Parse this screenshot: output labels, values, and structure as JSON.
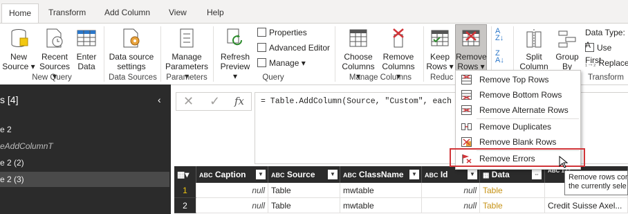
{
  "tabs": [
    {
      "label": "Home"
    },
    {
      "label": "Transform"
    },
    {
      "label": "Add Column"
    },
    {
      "label": "View"
    },
    {
      "label": "Help"
    }
  ],
  "ribbon": {
    "new_source": "New\nSource",
    "new_source_l1": "New",
    "new_source_l2": "Source",
    "recent_l1": "Recent",
    "recent_l2": "Sources",
    "enter_l1": "Enter",
    "enter_l2": "Data",
    "dss_l1": "Data source",
    "dss_l2": "settings",
    "manage_l1": "Manage",
    "manage_l2": "Parameters",
    "refresh_l1": "Refresh",
    "refresh_l2": "Preview",
    "properties": "Properties",
    "advanced_editor": "Advanced Editor",
    "manage": "Manage",
    "choose_l1": "Choose",
    "choose_l2": "Columns",
    "removec_l1": "Remove",
    "removec_l2": "Columns",
    "keep_l1": "Keep",
    "keep_l2": "Rows",
    "remover_l1": "Remove",
    "remover_l2": "Rows",
    "split_l1": "Split",
    "split_l2": "Column",
    "group_l1": "Group",
    "group_l2": "By",
    "data_type": "Data Type: A",
    "use_first": "Use First",
    "replace": "Replace",
    "groups": {
      "new_query": "New Query",
      "data_sources": "Data Sources",
      "parameters": "Parameters",
      "query": "Query",
      "manage_columns": "Manage Columns",
      "reduce": "Reduc",
      "transform": "Transform"
    }
  },
  "left_pane": {
    "title": "s [4]",
    "items": [
      {
        "label": "e 2"
      },
      {
        "label": "eAddColumnT"
      },
      {
        "label": "e 2 (2)"
      },
      {
        "label": "e 2 (3)"
      }
    ]
  },
  "formula": {
    "fx": "fx",
    "text": "= Table.AddColumn(Source, \"Custom\", each [D"
  },
  "grid": {
    "columns": [
      {
        "type": "ABC",
        "name": "Caption"
      },
      {
        "type": "ABC",
        "name": "Source"
      },
      {
        "type": "ABC",
        "name": "ClassName"
      },
      {
        "type": "ABC",
        "name": "Id"
      },
      {
        "type": "table",
        "name": "Data"
      },
      {
        "type": "ABC 123",
        "name": ""
      }
    ],
    "rows": [
      {
        "n": "1",
        "caption": "null",
        "source": "Table",
        "classname": "mwtable",
        "id": "null",
        "data": "Table",
        "extra": ""
      },
      {
        "n": "2",
        "caption": "null",
        "source": "Table",
        "classname": "mwtable",
        "id": "null",
        "data": "Table",
        "extra": "Credit Suisse Axel..."
      }
    ]
  },
  "menu": {
    "items": [
      {
        "label": "Remove Top Rows"
      },
      {
        "label": "Remove Bottom Rows"
      },
      {
        "label": "Remove Alternate Rows"
      },
      {
        "label": "Remove Duplicates"
      },
      {
        "label": "Remove Blank Rows"
      },
      {
        "label": "Remove Errors"
      }
    ]
  },
  "tooltip": {
    "line1": "Remove rows cor",
    "line2": "the currently sele"
  },
  "colors": {
    "accent_red": "#d13438",
    "dark_pane": "#2b2b2b",
    "table_link": "#c69214"
  }
}
